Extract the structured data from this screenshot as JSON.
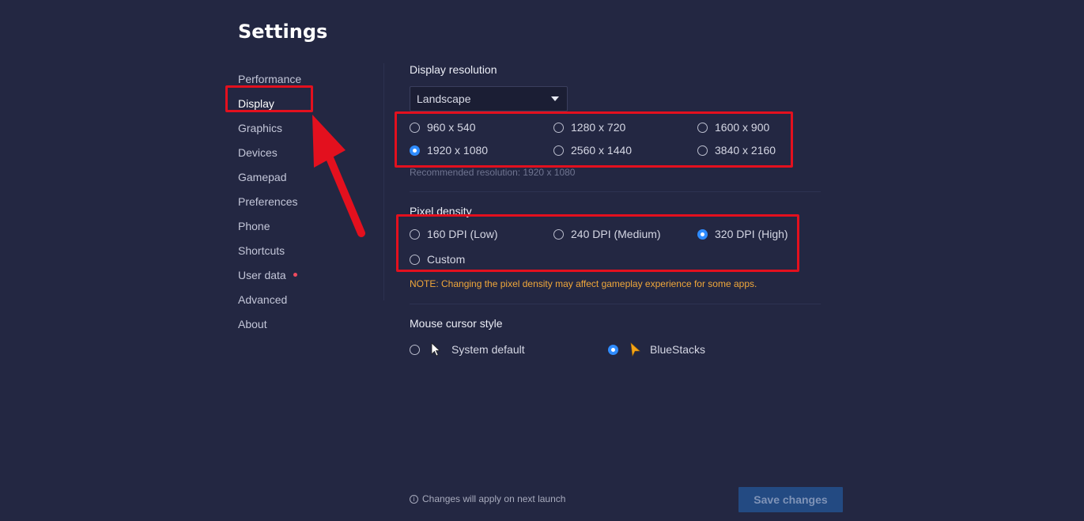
{
  "page": {
    "title": "Settings"
  },
  "sidebar": {
    "items": [
      {
        "label": "Performance",
        "active": false
      },
      {
        "label": "Display",
        "active": true
      },
      {
        "label": "Graphics",
        "active": false
      },
      {
        "label": "Devices",
        "active": false
      },
      {
        "label": "Gamepad",
        "active": false
      },
      {
        "label": "Preferences",
        "active": false
      },
      {
        "label": "Phone",
        "active": false
      },
      {
        "label": "Shortcuts",
        "active": false
      },
      {
        "label": "User data",
        "active": false,
        "has_dot": true
      },
      {
        "label": "Advanced",
        "active": false
      },
      {
        "label": "About",
        "active": false
      }
    ]
  },
  "display_resolution": {
    "label": "Display resolution",
    "orientation": "Landscape",
    "options": [
      "960 x 540",
      "1280 x 720",
      "1600 x 900",
      "1920 x 1080",
      "2560 x 1440",
      "3840 x 2160"
    ],
    "selected": "1920 x 1080",
    "hint": "Recommended resolution: 1920 x 1080"
  },
  "pixel_density": {
    "label": "Pixel density",
    "options": [
      "160 DPI (Low)",
      "240 DPI (Medium)",
      "320 DPI (High)",
      "Custom"
    ],
    "selected": "320 DPI (High)",
    "note": "NOTE: Changing the pixel density may affect gameplay experience for some apps."
  },
  "mouse_cursor": {
    "label": "Mouse cursor style",
    "options": [
      {
        "label": "System default",
        "icon": "arrow-cursor-icon"
      },
      {
        "label": "BlueStacks",
        "icon": "bluestacks-cursor-icon"
      }
    ],
    "selected": "BlueStacks"
  },
  "footer": {
    "info_icon": "info-icon",
    "note": "Changes will apply on next launch",
    "save_label": "Save changes"
  },
  "colors": {
    "background": "#232742",
    "accent": "#2f8cff",
    "annotation": "#e3101e",
    "note": "#f0a73a"
  }
}
